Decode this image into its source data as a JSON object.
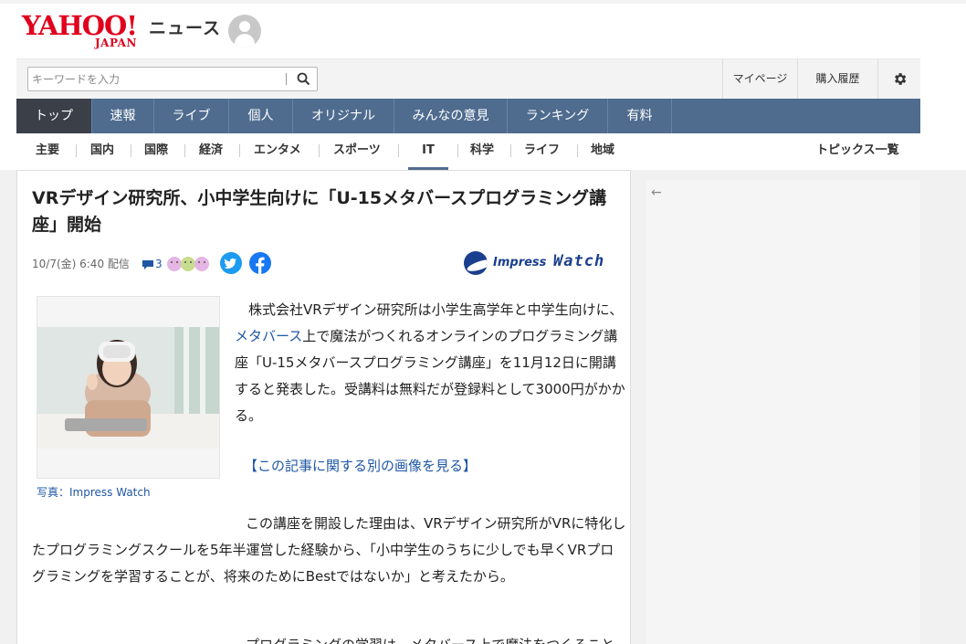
{
  "header": {
    "logo_main": "YAHOO!",
    "logo_sub": "JAPAN",
    "service": "ニュース"
  },
  "search": {
    "placeholder": "キーワードを入力",
    "value": ""
  },
  "utility": {
    "mypage": "マイページ",
    "history": "購入履歴",
    "settings_icon": "gear-icon"
  },
  "main_nav": [
    {
      "label": "トップ",
      "active": true
    },
    {
      "label": "速報"
    },
    {
      "label": "ライブ"
    },
    {
      "label": "個人"
    },
    {
      "label": "オリジナル"
    },
    {
      "label": "みんなの意見"
    },
    {
      "label": "ランキング"
    },
    {
      "label": "有料"
    }
  ],
  "sub_nav": [
    {
      "label": "主要"
    },
    {
      "label": "国内"
    },
    {
      "label": "国際"
    },
    {
      "label": "経済"
    },
    {
      "label": "エンタメ"
    },
    {
      "label": "スポーツ"
    },
    {
      "label": "IT",
      "active": true
    },
    {
      "label": "科学"
    },
    {
      "label": "ライフ"
    },
    {
      "label": "地域"
    }
  ],
  "topics_link": "トピックス一覧",
  "article": {
    "title": "VRデザイン研究所、小中学生向けに「U-15メタバースプログラミング講座」開始",
    "date": "10/7(金) 6:40 配信",
    "comment_count": "3",
    "publisher": "Impress Watch",
    "publisher_logo_text": "Impress",
    "publisher_logo_text2": "Watch",
    "photo_caption": "写真：Impress Watch",
    "para1_before": "株式会社VRデザイン研究所は小学生高学年と中学生向けに、",
    "para1_link": "メタバース",
    "para1_after": "上で魔法がつくれるオンラインのプログラミング講座「U-15メタバースプログラミング講座」を11月12日に開講すると発表した。受講料は無料だが登録料として3000円がかかる。",
    "more_images_link": "【この記事に関する別の画像を見る】",
    "para2": "この講座を開設した理由は、VRデザイン研究所がVRに特化したプログラミングスクールを5年半運営した経験から、「小中学生のうちに少しでも早くVRプログラミングを学習することが、将来のためにBestではないか」と考えたから。",
    "para3_partial": "プログラミングの学習は、メタバース上で魔法をつくることで"
  },
  "colors": {
    "brand_red": "#e1001c",
    "nav_blue": "#4f6c8f",
    "nav_active": "#3b3f48",
    "link_blue": "#1f57a5"
  }
}
